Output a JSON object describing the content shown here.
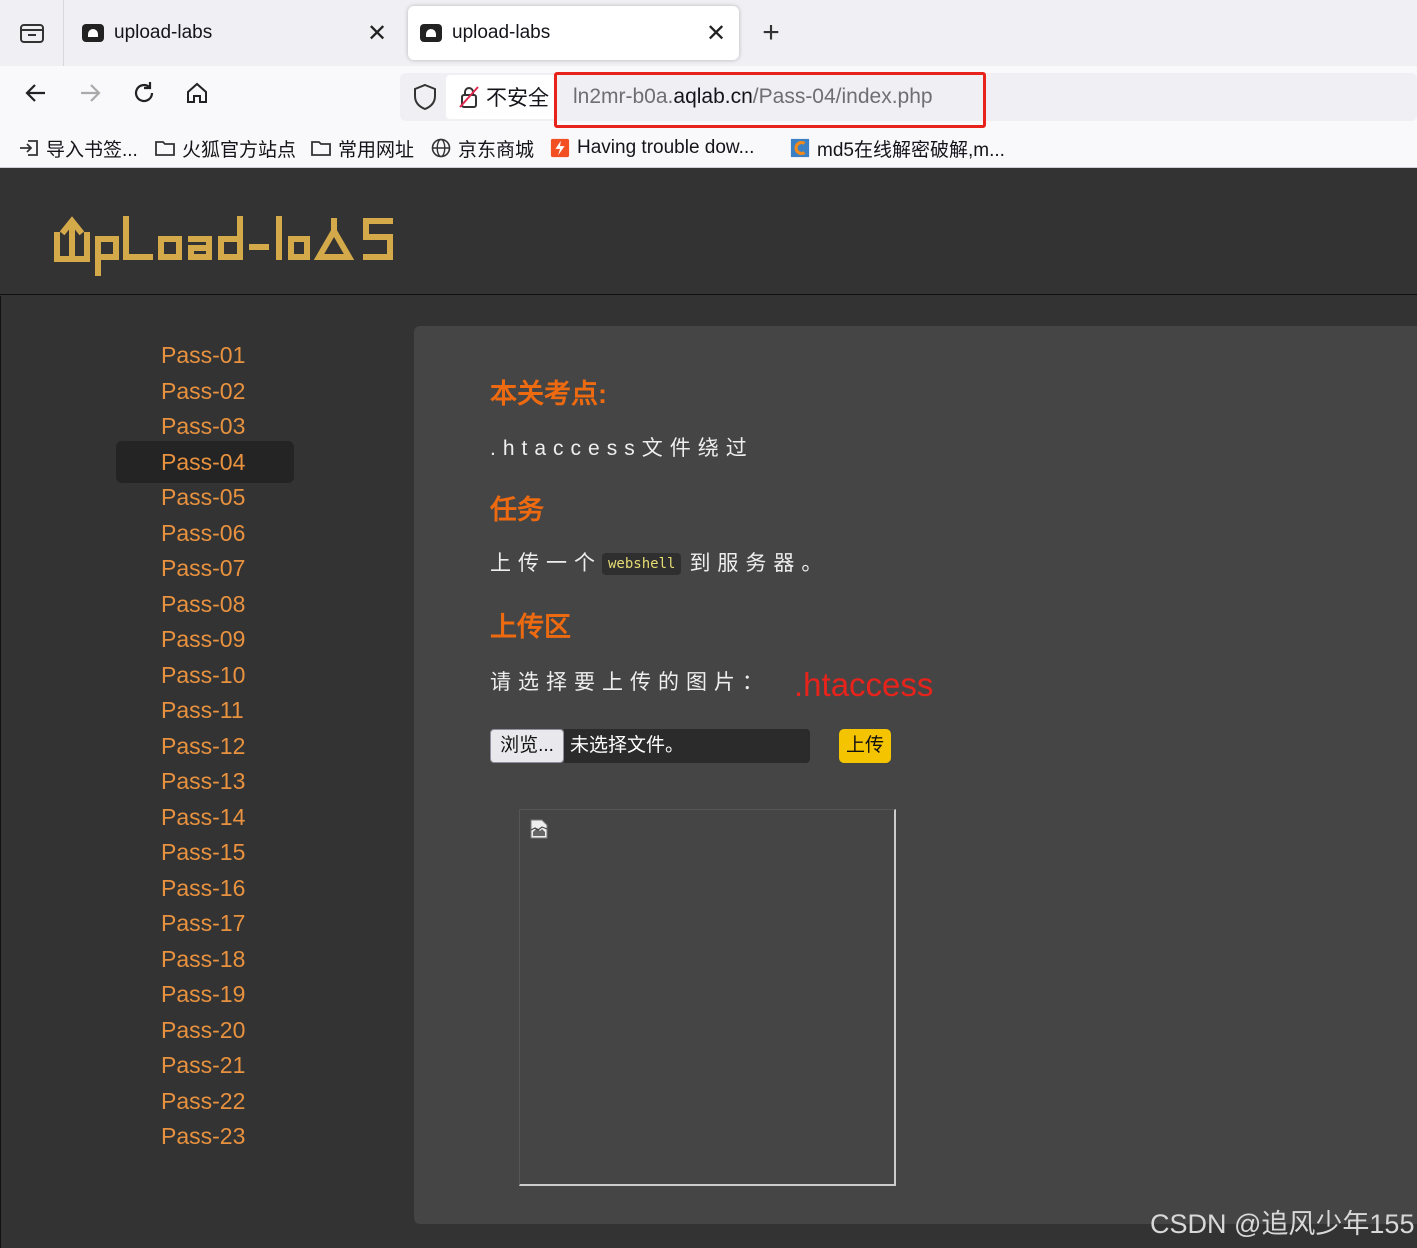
{
  "browser": {
    "tabs": [
      {
        "title": "upload-labs"
      },
      {
        "title": "upload-labs"
      }
    ],
    "close_glyph": "✕",
    "new_tab_glyph": "+",
    "security_label": "不安全",
    "url": {
      "prefix": "ln2mr-b0a.",
      "domain": "aqlab.cn",
      "path": "/Pass-04/index.php"
    },
    "bookmarks": [
      {
        "label": "导入书签...",
        "icon": "import-icon"
      },
      {
        "label": "火狐官方站点",
        "icon": "folder-icon"
      },
      {
        "label": "常用网址",
        "icon": "folder-icon"
      },
      {
        "label": "京东商城",
        "icon": "globe-icon"
      },
      {
        "label": "Having trouble dow...",
        "icon": "flash-icon"
      },
      {
        "label": "md5在线解密破解,m...",
        "icon": "cmd5-icon"
      }
    ]
  },
  "page": {
    "logo": "UpLoad-labs",
    "nav": [
      "Pass-01",
      "Pass-02",
      "Pass-03",
      "Pass-04",
      "Pass-05",
      "Pass-06",
      "Pass-07",
      "Pass-08",
      "Pass-09",
      "Pass-10",
      "Pass-11",
      "Pass-12",
      "Pass-13",
      "Pass-14",
      "Pass-15",
      "Pass-16",
      "Pass-17",
      "Pass-18",
      "Pass-19",
      "Pass-20",
      "Pass-21",
      "Pass-22",
      "Pass-23"
    ],
    "active_nav": "Pass-04",
    "section_point_title": "本关考点:",
    "section_point_text": ".htaccess文件绕过",
    "section_task_title": "任务",
    "task_before": "上传一个",
    "task_code": "webshell",
    "task_after": "到服务器。",
    "section_upload_title": "上传区",
    "upload_prompt": "请选择要上传的图片：",
    "annotation": ".htaccess",
    "browse_label": "浏览...",
    "file_placeholder": "未选择文件。",
    "upload_button": "上传"
  },
  "watermark": "CSDN @追风少年155",
  "colors": {
    "accent_orange": "#ee6a10",
    "nav_orange": "#e8923f",
    "annotation_red": "#e8231c",
    "upload_button_yellow": "#f5c400",
    "logo_gold": "#d4a94a"
  }
}
